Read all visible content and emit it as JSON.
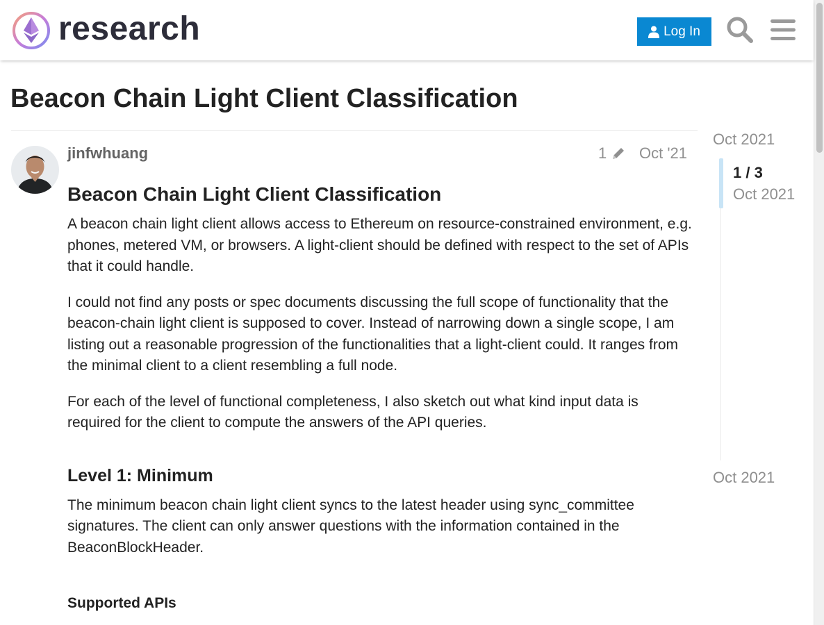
{
  "header": {
    "logo_text": "research",
    "login_label": "Log In",
    "search_icon": "search-icon",
    "menu_icon": "hamburger-menu-icon",
    "brand_color": "#0a88d2"
  },
  "topic": {
    "title": "Beacon Chain Light Client Classification"
  },
  "post": {
    "username": "jinfwhuang",
    "edit_count": "1",
    "date": "Oct '21",
    "heading": "Beacon Chain Light Client Classification",
    "paragraphs": [
      "A beacon chain light client allows access to Ethereum on resource-constrained environment, e.g. phones, metered VM, or browsers. A light-client should be defined with respect to the set of APIs that it could handle.",
      "I could not find any posts or spec documents discussing the full scope of functionality that the beacon-chain light client is supposed to cover. Instead of narrowing down a single scope, I am listing out a reasonable progression of the functionalities that a light-client could. It ranges from the minimal client to a client resembling a full node.",
      "For each of the level of functional completeness, I also sketch out what kind input data is required for the client to compute the answers of the API queries."
    ],
    "section_heading": "Level 1: Minimum",
    "section_paragraph": "The minimum beacon chain light client syncs to the latest header using sync_committee signatures. The client can only answer questions with the information contained in the BeaconBlockHeader.",
    "subsection_heading": "Supported APIs"
  },
  "timeline": {
    "start_date": "Oct 2021",
    "position": "1 / 3",
    "position_date": "Oct 2021",
    "end_date": "Oct 2021"
  }
}
